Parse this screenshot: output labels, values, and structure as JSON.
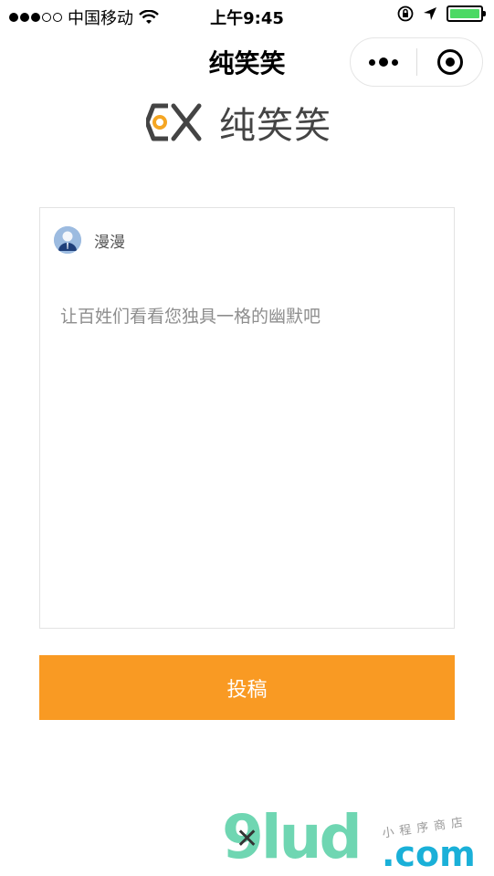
{
  "status_bar": {
    "carrier": "中国移动",
    "time": "上午9:45",
    "battery_level": 1.0,
    "battery_color": "#4cd964"
  },
  "nav": {
    "title": "纯笑笑",
    "more_icon": "more-dots-icon",
    "close_icon": "target-circle-icon"
  },
  "brand": {
    "name": "纯笑笑",
    "logo_color": "#f5a623",
    "logo_stroke": "#444444"
  },
  "post": {
    "username": "漫漫",
    "placeholder": "让百姓们看看您独具一格的幽默吧"
  },
  "submit": {
    "label": "投稿",
    "color": "#f99a23"
  },
  "watermark": {
    "logo_text": "9lud",
    "tagline": "小程序商店",
    "domain": ".com"
  }
}
